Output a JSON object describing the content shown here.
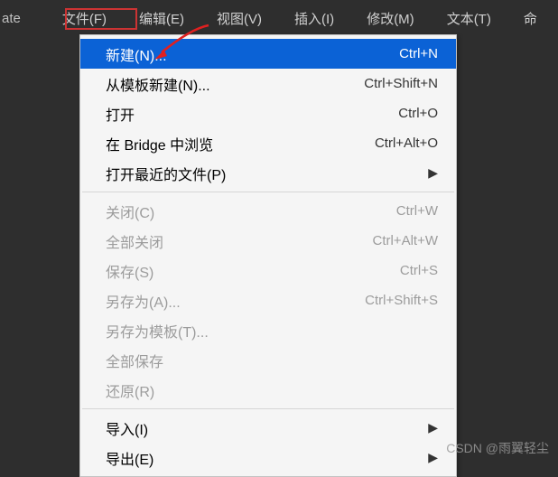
{
  "menubar": {
    "app_fragment": "ate",
    "items": [
      "文件(F)",
      "编辑(E)",
      "视图(V)",
      "插入(I)",
      "修改(M)",
      "文本(T)",
      "命"
    ]
  },
  "dropdown": {
    "items": [
      {
        "label": "新建(N)...",
        "shortcut": "Ctrl+N",
        "enabled": true,
        "highlighted": true
      },
      {
        "label": "从模板新建(N)...",
        "shortcut": "Ctrl+Shift+N",
        "enabled": true
      },
      {
        "label": "打开",
        "shortcut": "Ctrl+O",
        "enabled": true
      },
      {
        "label": "在 Bridge 中浏览",
        "shortcut": "Ctrl+Alt+O",
        "enabled": true
      },
      {
        "label": "打开最近的文件(P)",
        "submenu": true,
        "enabled": true
      },
      {
        "separator": true
      },
      {
        "label": "关闭(C)",
        "shortcut": "Ctrl+W",
        "enabled": false
      },
      {
        "label": "全部关闭",
        "shortcut": "Ctrl+Alt+W",
        "enabled": false
      },
      {
        "label": "保存(S)",
        "shortcut": "Ctrl+S",
        "enabled": false
      },
      {
        "label": "另存为(A)...",
        "shortcut": "Ctrl+Shift+S",
        "enabled": false
      },
      {
        "label": "另存为模板(T)...",
        "enabled": false
      },
      {
        "label": "全部保存",
        "enabled": false
      },
      {
        "label": "还原(R)",
        "enabled": false
      },
      {
        "separator": true
      },
      {
        "label": "导入(I)",
        "submenu": true,
        "enabled": true
      },
      {
        "label": "导出(E)",
        "submenu": true,
        "enabled": true
      }
    ]
  },
  "watermark": "CSDN @雨翼轻尘",
  "arrow_glyph": "▶"
}
